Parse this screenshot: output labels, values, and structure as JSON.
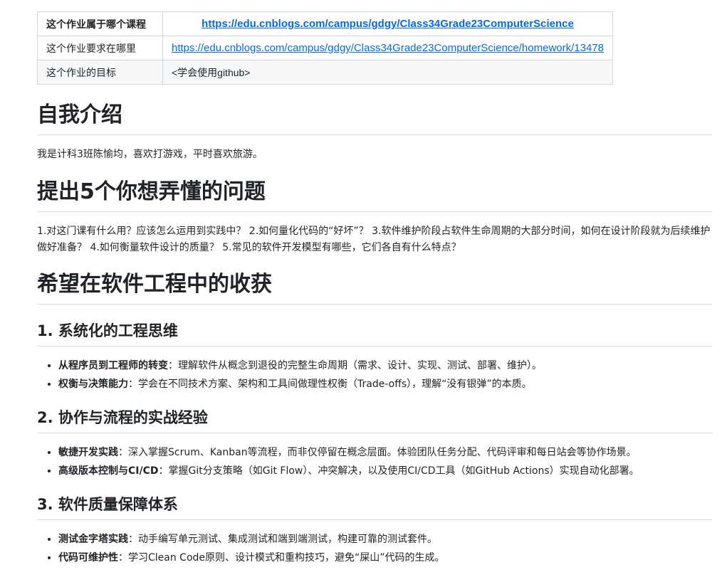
{
  "table": {
    "rows": [
      {
        "key": "这个作业属于哪个课程",
        "value": "https://edu.cnblogs.com/campus/gdgy/Class34Grade23ComputerScience"
      },
      {
        "key": "这个作业要求在哪里",
        "value": "https://edu.cnblogs.com/campus/gdgy/Class34Grade23ComputerScience/homework/13478"
      },
      {
        "key": "这个作业的目标",
        "value": "<学会使用github>"
      }
    ]
  },
  "intro": {
    "heading": "自我介绍",
    "text": "我是计科3班陈愉均，喜欢打游戏，平时喜欢旅游。"
  },
  "questions": {
    "heading": "提出5个你想弄懂的问题",
    "text": "1.对这门课有什么用？应该怎么运用到实践中？ 2.如何量化代码的“好坏”？ 3.软件维护阶段占软件生命周期的大部分时间，如何在设计阶段就为后续维护做好准备？ 4.如何衡量软件设计的质量？ 5.常见的软件开发模型有哪些，它们各自有什么特点？"
  },
  "gains": {
    "heading": "希望在软件工程中的收获",
    "sections": [
      {
        "title": "1. 系统化的工程思维",
        "items": [
          {
            "bold": "从程序员到工程师的转变",
            "text": "：理解软件从概念到退役的完整生命周期（需求、设计、实现、测试、部署、维护）。"
          },
          {
            "bold": "权衡与决策能力",
            "text": "：学会在不同技术方案、架构和工具间做理性权衡（Trade-offs），理解“没有银弹”的本质。"
          }
        ]
      },
      {
        "title": "2. 协作与流程的实战经验",
        "items": [
          {
            "bold": "敏捷开发实践",
            "text": "：深入掌握Scrum、Kanban等流程，而非仅停留在概念层面。体验团队任务分配、代码评审和每日站会等协作场景。"
          },
          {
            "bold": "高级版本控制与CI/CD",
            "text": "：掌握Git分支策略（如Git Flow）、冲突解决，以及使用CI/CD工具（如GitHub Actions）实现自动化部署。"
          }
        ]
      },
      {
        "title": "3. 软件质量保障体系",
        "items": [
          {
            "bold": "测试金字塔实践",
            "text": "：动手编写单元测试、集成测试和端到端测试，构建可靠的测试套件。"
          },
          {
            "bold": "代码可维护性",
            "text": "：学习Clean Code原则、设计模式和重构技巧，避免“屎山”代码的生成。"
          }
        ]
      }
    ]
  }
}
